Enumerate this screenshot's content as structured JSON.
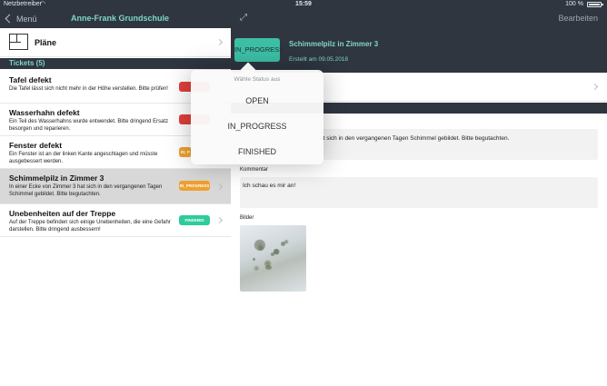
{
  "status_bar": {
    "carrier": "Netzbetreiber",
    "time": "15:59",
    "battery_text": "100 %",
    "battery_level": 1.0
  },
  "navbar": {
    "back_label": "Menü",
    "title": "Anne-Frank Grundschule",
    "edit_label": "Bearbeiten"
  },
  "plans": {
    "label": "Pläne"
  },
  "tickets_section": {
    "title": "Tickets (5)"
  },
  "tickets": [
    {
      "title": "Tafel defekt",
      "description": "Die Tafel lässt sich nicht mehr in der Höhe verstellen. Bitte prüfen!",
      "status": "OPEN",
      "selected": false
    },
    {
      "title": "Wasserhahn defekt",
      "description": "Ein Teil des Wasserhahns wurde entwendet. Bitte dringend Ersatz besorgen und reparieren.",
      "status": "OPEN",
      "selected": false
    },
    {
      "title": "Fenster defekt",
      "description": "Ein Fenster ist an der linken Kante angeschlagen und müsste ausgebessert werden.",
      "status": "IN_PROGRESS",
      "badge_label": "IN_P",
      "selected": false
    },
    {
      "title": "Schimmelpilz in Zimmer 3",
      "description": "In einer Ecke von Zimmer 3 hat sich in den vergangenen Tagen Schimmel gebildet. Bitte begutachten.",
      "status": "IN_PROGRESS",
      "badge_label": "IN_PROGRESS",
      "selected": true
    },
    {
      "title": "Unebenheiten auf der Treppe",
      "description": "Auf der Treppe befinden sich einige Unebenheiten, die eine Gefahr darstellen. Bitte dringend ausbessern!",
      "status": "FINISHED",
      "badge_label": "FINISHED",
      "selected": false
    }
  ],
  "detail": {
    "status_label": "IN_PROGRESS",
    "title": "Schimmelpilz in Zimmer 3",
    "created": "Erstellt am 09.05.2018",
    "description_visible": "at sich in den vergangenen Tagen Schimmel gebildet. Bitte begutachten.",
    "comment_label": "Kommentar",
    "comment": "Ich schau es mir an!",
    "images_label": "Bilder"
  },
  "status_popover": {
    "hint": "Wähle Status aus",
    "options": [
      "OPEN",
      "IN_PROGRESS",
      "FINISHED"
    ]
  },
  "colors": {
    "dark": "#2f3640",
    "accent": "#7fd6c4",
    "status_open": "#e0403c",
    "status_in_progress": "#f0a030",
    "status_finished": "#2ecc9a"
  }
}
